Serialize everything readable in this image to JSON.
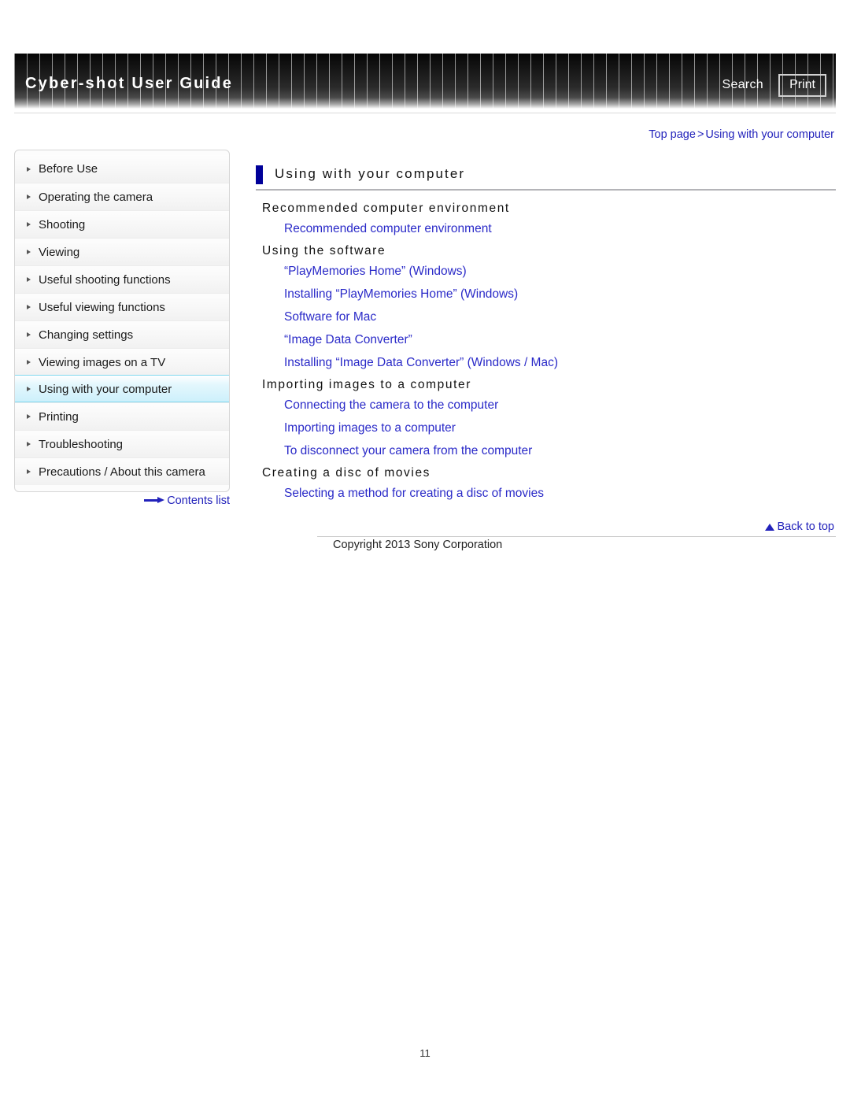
{
  "header": {
    "title": "Cyber-shot User Guide",
    "search_label": "Search",
    "print_label": "Print"
  },
  "breadcrumb": {
    "top_label": "Top page",
    "separator": ">",
    "current_label": "Using with your computer"
  },
  "sidebar": {
    "items": [
      {
        "label": "Before Use",
        "active": false
      },
      {
        "label": "Operating the camera",
        "active": false
      },
      {
        "label": "Shooting",
        "active": false
      },
      {
        "label": "Viewing",
        "active": false
      },
      {
        "label": "Useful shooting functions",
        "active": false
      },
      {
        "label": "Useful viewing functions",
        "active": false
      },
      {
        "label": "Changing settings",
        "active": false
      },
      {
        "label": "Viewing images on a TV",
        "active": false
      },
      {
        "label": "Using with your computer",
        "active": true
      },
      {
        "label": "Printing",
        "active": false
      },
      {
        "label": "Troubleshooting",
        "active": false
      },
      {
        "label": "Precautions / About this camera",
        "active": false
      }
    ],
    "contents_list_label": "Contents list"
  },
  "main": {
    "page_title": "Using with your computer",
    "sections": [
      {
        "heading": "Recommended computer environment",
        "links": [
          "Recommended computer environment"
        ]
      },
      {
        "heading": "Using the software",
        "links": [
          "“PlayMemories Home” (Windows)",
          "Installing “PlayMemories Home” (Windows)",
          "Software for Mac",
          "“Image Data Converter”",
          "Installing “Image Data Converter” (Windows / Mac)"
        ]
      },
      {
        "heading": "Importing images to a computer",
        "links": [
          "Connecting the camera to the computer",
          "Importing images to a computer",
          "To disconnect your camera from the computer"
        ]
      },
      {
        "heading": "Creating a disc of movies",
        "links": [
          "Selecting a method for creating a disc of movies"
        ]
      }
    ]
  },
  "footer": {
    "back_to_top_label": "Back to top",
    "copyright": "Copyright 2013 Sony Corporation",
    "page_number": "11"
  },
  "colors": {
    "link_blue": "#2a2ac8",
    "breadcrumb_blue": "#2222bb",
    "title_accent": "#000099",
    "active_item_cyan": "#cdf0fb"
  }
}
